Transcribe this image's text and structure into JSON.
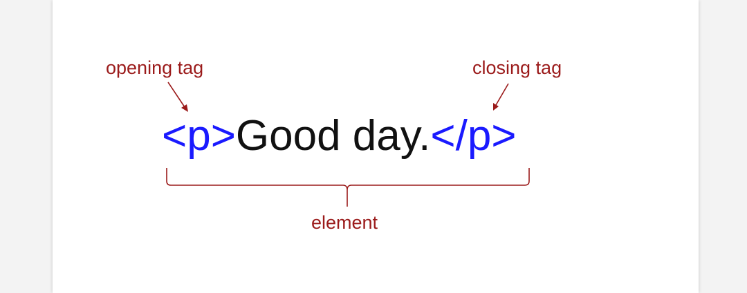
{
  "colors": {
    "tag": "#1a1aff",
    "text": "#111111",
    "annotation": "#9b1b1b",
    "page_background": "#f3f3f3",
    "card_background": "#ffffff"
  },
  "labels": {
    "opening": "opening tag",
    "closing": "closing tag",
    "element": "element"
  },
  "code": {
    "open_tag": "<p>",
    "content": "Good day.",
    "close_tag": "</p>"
  }
}
